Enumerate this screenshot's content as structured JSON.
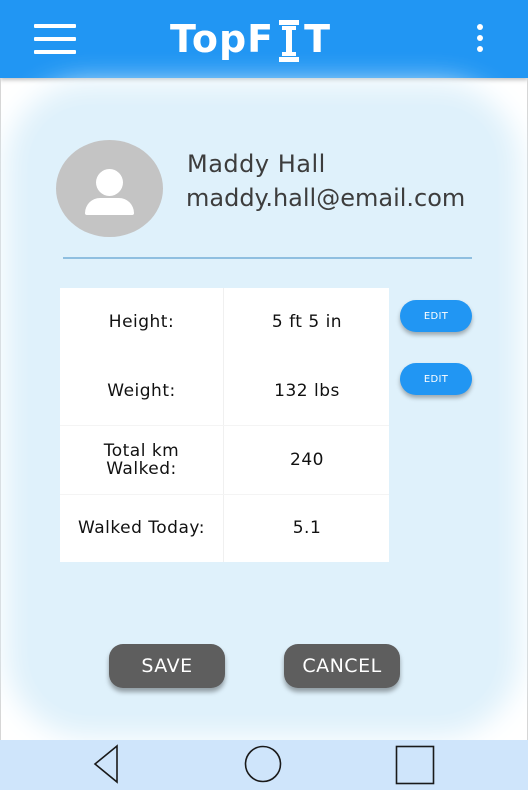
{
  "app": {
    "title": "TopFIT",
    "logo_left": "TopF",
    "logo_right": "T",
    "brand_color": "#2196F3"
  },
  "profile": {
    "name": "Maddy Hall",
    "email": "maddy.hall@email.com",
    "avatar_icon": "person-icon"
  },
  "stats": [
    {
      "label": "Height:",
      "value": "5 ft 5 in"
    },
    {
      "label": "Weight:",
      "value": "132 lbs"
    },
    {
      "label": "Total km Walked:",
      "value": "240"
    },
    {
      "label": "Walked Today:",
      "value": "5.1"
    }
  ],
  "edit_buttons": [
    {
      "label": "EDIT"
    },
    {
      "label": "EDIT"
    }
  ],
  "actions": {
    "save_label": "SAVE",
    "cancel_label": "CANCEL"
  },
  "icons": {
    "menu": "hamburger-menu-icon",
    "overflow": "more-vert-icon",
    "back": "back-triangle-icon",
    "home": "home-circle-icon",
    "recent": "recent-apps-square-icon"
  }
}
